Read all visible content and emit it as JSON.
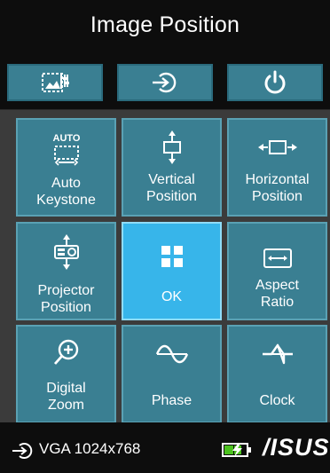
{
  "header": {
    "title": "Image Position"
  },
  "top_buttons": [
    {
      "name": "picture-settings",
      "icon": "image-settings-icon"
    },
    {
      "name": "input-source",
      "icon": "input-source-icon"
    },
    {
      "name": "power",
      "icon": "power-icon"
    }
  ],
  "tiles": [
    {
      "id": "auto-keystone",
      "badge": "AUTO",
      "label": "Auto\nKeystone",
      "icon": "auto-keystone-icon"
    },
    {
      "id": "vertical-position",
      "label": "Vertical\nPosition",
      "icon": "vertical-position-icon"
    },
    {
      "id": "horizontal-position",
      "label": "Horizontal\nPosition",
      "icon": "horizontal-position-icon"
    },
    {
      "id": "projector-position",
      "label": "Projector\nPosition",
      "icon": "projector-position-icon"
    },
    {
      "id": "ok",
      "label": "OK",
      "icon": "grid-icon",
      "selected": true
    },
    {
      "id": "aspect-ratio",
      "label": "Aspect\nRatio",
      "icon": "aspect-ratio-icon"
    },
    {
      "id": "digital-zoom",
      "label": "Digital\nZoom",
      "icon": "zoom-in-icon"
    },
    {
      "id": "phase",
      "label": "Phase",
      "icon": "phase-wave-icon"
    },
    {
      "id": "clock",
      "label": "Clock",
      "icon": "clock-wave-icon"
    }
  ],
  "status_bar": {
    "source_icon": "input-source-icon",
    "source_text": "VGA 1024x768",
    "battery_icon": "battery-charging-icon",
    "brand": "/ISUS"
  },
  "colors": {
    "tile": "#3a7f92",
    "tile_selected": "#37b5ea",
    "background": "#0d0d0d",
    "grid_background": "#3b3b3b",
    "battery_green": "#4cc21f"
  }
}
